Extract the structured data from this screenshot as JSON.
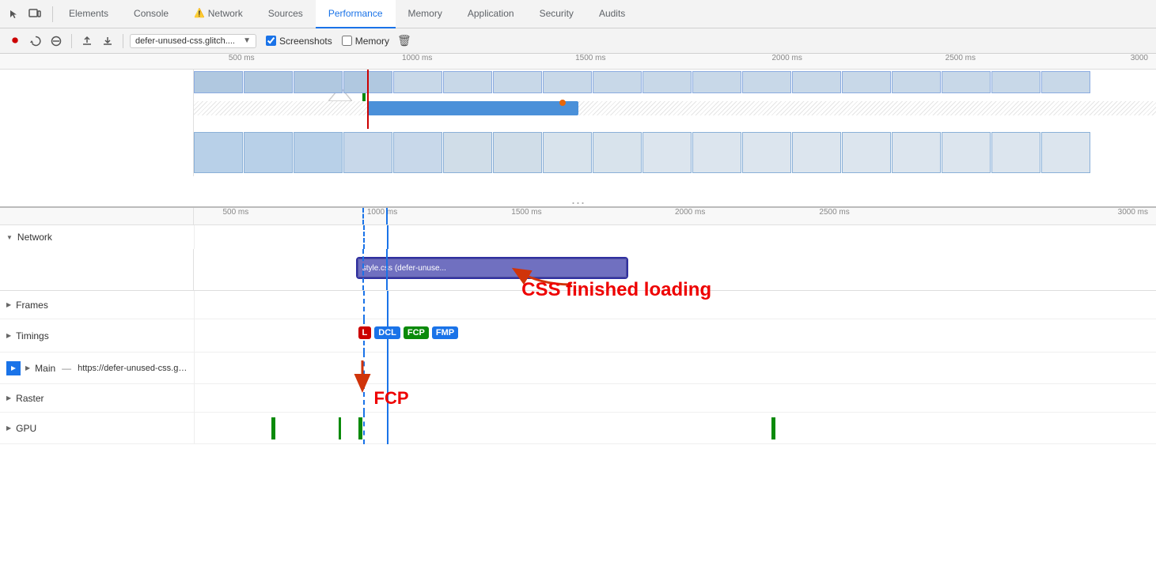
{
  "tabs": [
    {
      "id": "elements",
      "label": "Elements",
      "active": false,
      "warn": false
    },
    {
      "id": "console",
      "label": "Console",
      "active": false,
      "warn": false
    },
    {
      "id": "network",
      "label": "Network",
      "active": false,
      "warn": true
    },
    {
      "id": "sources",
      "label": "Sources",
      "active": false,
      "warn": false
    },
    {
      "id": "performance",
      "label": "Performance",
      "active": true,
      "warn": false
    },
    {
      "id": "memory",
      "label": "Memory",
      "active": false,
      "warn": false
    },
    {
      "id": "application",
      "label": "Application",
      "active": false,
      "warn": false
    },
    {
      "id": "security",
      "label": "Security",
      "active": false,
      "warn": false
    },
    {
      "id": "audits",
      "label": "Audits",
      "active": false,
      "warn": false
    }
  ],
  "toolbar": {
    "url_value": "defer-unused-css.glitch....",
    "screenshots_label": "Screenshots",
    "memory_label": "Memory",
    "screenshots_checked": true,
    "memory_checked": false
  },
  "ruler": {
    "ticks": [
      "500 ms",
      "1000 ms",
      "1500 ms",
      "2000 ms",
      "2500 ms",
      "3000 ms"
    ],
    "ticks_detail": [
      "500 ms",
      "1000 ms",
      "1500 ms",
      "2000 ms",
      "2500 ms",
      "3000 ms"
    ]
  },
  "network_section": {
    "label": "Network",
    "resource_bar_label": "style.css (defer-unuse...",
    "annotation_text": "CSS finished loading",
    "fcp_annotation": "FCP"
  },
  "tracks": [
    {
      "id": "frames",
      "label": "Frames",
      "arrow": "▶"
    },
    {
      "id": "timings",
      "label": "Timings",
      "arrow": "▶"
    },
    {
      "id": "main",
      "label": "Main",
      "arrow": "▶",
      "url": "https://defer-unused-css.glitch.me/index-optimized.html"
    },
    {
      "id": "raster",
      "label": "Raster",
      "arrow": "▶"
    },
    {
      "id": "gpu",
      "label": "GPU",
      "arrow": "▶"
    }
  ],
  "timing_badges": [
    {
      "id": "L",
      "label": "L",
      "class": "badge-l"
    },
    {
      "id": "DCL",
      "label": "DCL",
      "class": "badge-dcl"
    },
    {
      "id": "FCP",
      "label": "FCP",
      "class": "badge-fcp"
    },
    {
      "id": "FMP",
      "label": "FMP",
      "class": "badge-fmp"
    }
  ]
}
